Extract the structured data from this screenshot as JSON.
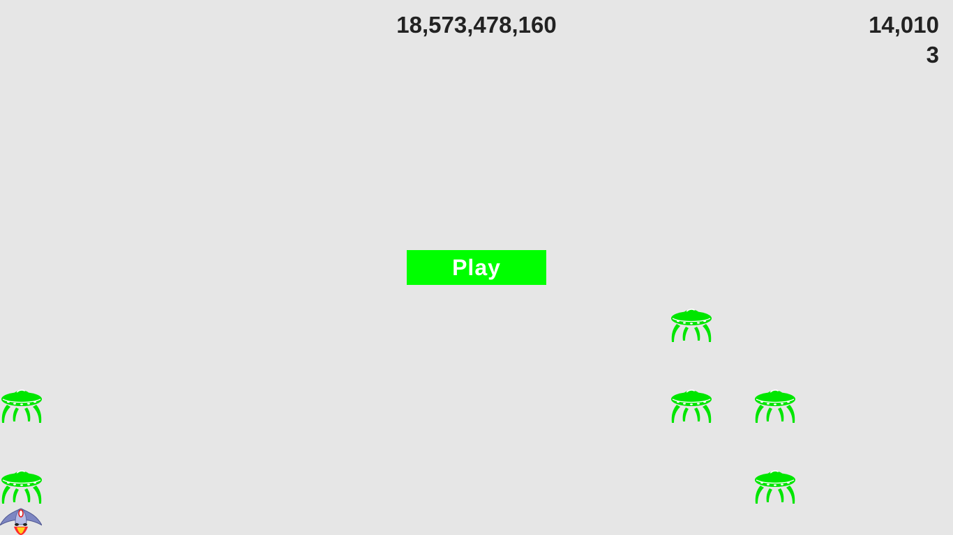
{
  "hud": {
    "high_score": "18,573,478,160",
    "score": "14,010",
    "level": "3"
  },
  "play_button": {
    "label": "Play",
    "color": "#00ff00"
  },
  "aliens": {
    "color": "#00e600",
    "icon": "alien-ufo-icon"
  },
  "ship": {
    "icon": "rocket-ship-icon"
  }
}
